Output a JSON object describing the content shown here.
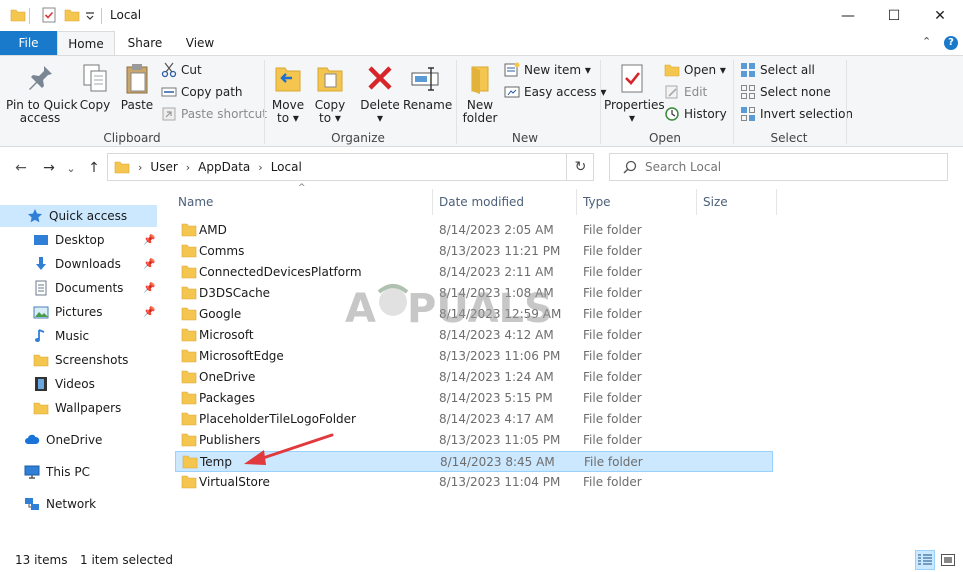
{
  "window": {
    "title": "Local",
    "minimize_glyph": "—",
    "maximize_glyph": "☐",
    "close_glyph": "✕"
  },
  "ribbon_tabs": {
    "file": "File",
    "home": "Home",
    "share": "Share",
    "view": "View",
    "collapse_glyph": "⌃",
    "help_glyph": "?"
  },
  "clipboard": {
    "group": "Clipboard",
    "pin_line1": "Pin to Quick",
    "pin_line2": "access",
    "copy": "Copy",
    "paste": "Paste",
    "cut": "Cut",
    "copy_path": "Copy path",
    "paste_shortcut": "Paste shortcut"
  },
  "organize": {
    "group": "Organize",
    "move_line1": "Move",
    "move_line2": "to ▾",
    "copy_line1": "Copy",
    "copy_line2": "to ▾",
    "delete_line1": "Delete",
    "delete_line2": "▾",
    "rename": "Rename"
  },
  "new": {
    "group": "New",
    "folder_line1": "New",
    "folder_line2": "folder",
    "new_item": "New item ▾",
    "easy_access": "Easy access ▾"
  },
  "open": {
    "group": "Open",
    "properties_line1": "Properties",
    "properties_line2": "▾",
    "open": "Open ▾",
    "edit": "Edit",
    "history": "History"
  },
  "select": {
    "group": "Select",
    "select_all": "Select all",
    "select_none": "Select none",
    "invert": "Invert selection"
  },
  "address": {
    "crumbs": [
      "User",
      "AppData",
      "Local"
    ],
    "sep": "›",
    "dropdown_glyph": "⌄",
    "refresh_glyph": "↻",
    "back_glyph": "←",
    "forward_glyph": "→",
    "recent_glyph": "⌄",
    "up_glyph": "↑"
  },
  "search": {
    "placeholder": "Search Local"
  },
  "nav": {
    "quick_access": "Quick access",
    "desktop": "Desktop",
    "downloads": "Downloads",
    "documents": "Documents",
    "pictures": "Pictures",
    "music": "Music",
    "screenshots": "Screenshots",
    "videos": "Videos",
    "wallpapers": "Wallpapers",
    "onedrive": "OneDrive",
    "this_pc": "This PC",
    "network": "Network"
  },
  "columns": {
    "name": "Name",
    "date": "Date modified",
    "type": "Type",
    "size": "Size",
    "sort_glyph": "^"
  },
  "files": [
    {
      "name": "AMD",
      "date": "8/14/2023 2:05 AM",
      "type": "File folder"
    },
    {
      "name": "Comms",
      "date": "8/13/2023 11:21 PM",
      "type": "File folder"
    },
    {
      "name": "ConnectedDevicesPlatform",
      "date": "8/14/2023 2:11 AM",
      "type": "File folder"
    },
    {
      "name": "D3DSCache",
      "date": "8/14/2023 1:08 AM",
      "type": "File folder"
    },
    {
      "name": "Google",
      "date": "8/14/2023 12:59 AM",
      "type": "File folder"
    },
    {
      "name": "Microsoft",
      "date": "8/14/2023 4:12 AM",
      "type": "File folder"
    },
    {
      "name": "MicrosoftEdge",
      "date": "8/13/2023 11:06 PM",
      "type": "File folder"
    },
    {
      "name": "OneDrive",
      "date": "8/14/2023 1:24 AM",
      "type": "File folder"
    },
    {
      "name": "Packages",
      "date": "8/14/2023 5:15 PM",
      "type": "File folder"
    },
    {
      "name": "PlaceholderTileLogoFolder",
      "date": "8/14/2023 4:17 AM",
      "type": "File folder"
    },
    {
      "name": "Publishers",
      "date": "8/13/2023 11:05 PM",
      "type": "File folder"
    },
    {
      "name": "Temp",
      "date": "8/14/2023 8:45 AM",
      "type": "File folder"
    },
    {
      "name": "VirtualStore",
      "date": "8/13/2023 11:04 PM",
      "type": "File folder"
    }
  ],
  "status": {
    "count": "13 items",
    "selected": "1 item selected"
  },
  "colors": {
    "accent": "#1979ca",
    "selection": "#cce8ff",
    "selection_border": "#99d1ff",
    "folder": "#f4c64f",
    "arrow": "#e0393e"
  }
}
